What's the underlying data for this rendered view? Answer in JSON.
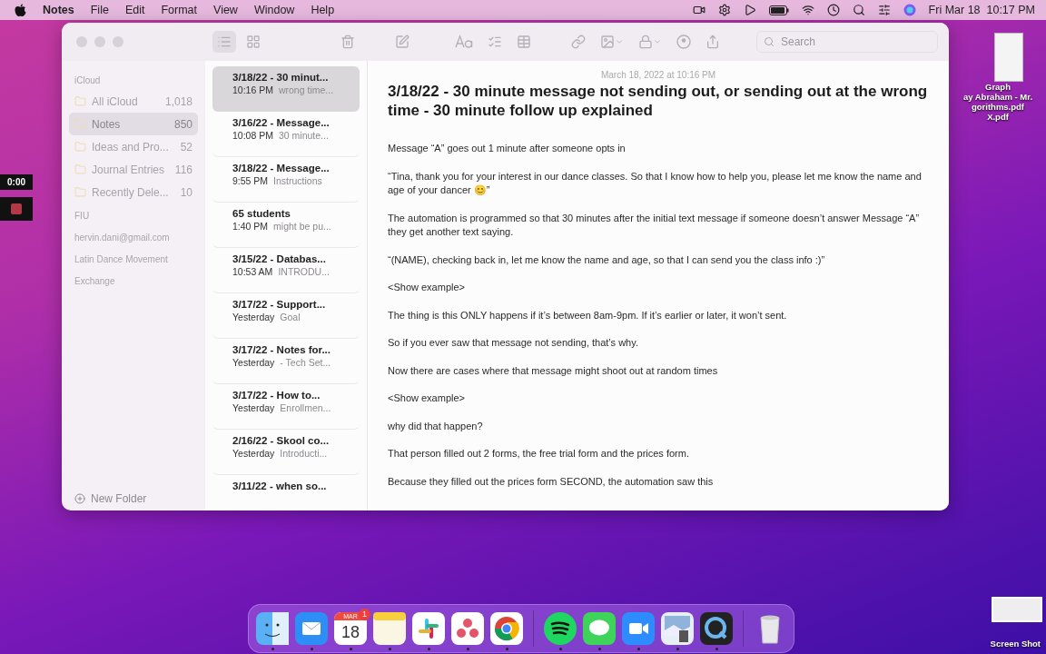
{
  "menu_bar": {
    "app_name": "Notes",
    "menus": [
      "File",
      "Edit",
      "Format",
      "View",
      "Window",
      "Help"
    ],
    "clock": "Fri Mar 18  10:17 PM"
  },
  "toolbar": {
    "view_modes": [
      {
        "kind": "list",
        "selected": true
      },
      {
        "kind": "grid",
        "selected": false
      }
    ],
    "search": {
      "placeholder": "Search"
    }
  },
  "sidebar": {
    "sections": [
      {
        "title": "iCloud",
        "folders": [
          {
            "name": "All iCloud",
            "count": "1,018",
            "selected": false
          },
          {
            "name": "Notes",
            "count": "850",
            "selected": true
          },
          {
            "name": "Ideas and Pro...",
            "count": "52",
            "selected": false
          },
          {
            "name": "Journal Entries",
            "count": "116",
            "selected": false
          },
          {
            "name": "Recently Dele...",
            "count": "10",
            "selected": false
          }
        ]
      },
      {
        "title": "FIU"
      },
      {
        "title": "hervin.dani@gmail.com"
      },
      {
        "title": "Latin Dance Movement"
      },
      {
        "title": "Exchange"
      }
    ],
    "new_folder": "New Folder"
  },
  "note_list": [
    {
      "title": "3/18/22 - 30 minut...",
      "time": "10:16 PM",
      "preview": "wrong time...",
      "selected": true
    },
    {
      "title": "3/16/22 - Message...",
      "time": "10:08 PM",
      "preview": "30 minute...",
      "selected": false
    },
    {
      "title": "3/18/22 - Message...",
      "time": "9:55 PM",
      "preview": "Instructions",
      "selected": false
    },
    {
      "title": "65 students",
      "time": "1:40 PM",
      "preview": "might be pu...",
      "selected": false
    },
    {
      "title": "3/15/22 - Databas...",
      "time": "10:53 AM",
      "preview": "INTRODU...",
      "selected": false
    },
    {
      "title": "3/17/22 - Support...",
      "time": "Yesterday",
      "preview": "Goal",
      "selected": false
    },
    {
      "title": "3/17/22 - Notes for...",
      "time": "Yesterday",
      "preview": "- Tech Set...",
      "selected": false
    },
    {
      "title": "3/17/22 - How to...",
      "time": "Yesterday",
      "preview": "Enrollmen...",
      "selected": false
    },
    {
      "title": "2/16/22 - Skool co...",
      "time": "Yesterday",
      "preview": "Introducti...",
      "selected": false
    },
    {
      "title": "3/11/22 - when so...",
      "selected": false
    }
  ],
  "note": {
    "date": "March 18, 2022 at 10:16 PM",
    "title": "3/18/22 - 30 minute message not sending out, or sending out at the wrong time - 30 minute follow up explained",
    "paragraphs": [
      "Message “A” goes out 1 minute after someone opts in",
      "“Tina, thank you for your interest in our dance classes. So that I know how to help you, please let me know the name and age of your dancer 😊”",
      "The automation is programmed so that 30 minutes after the initial text message if someone doesn’t answer Message “A” they get another text saying.",
      "“(NAME), checking back in, let me know the name and age, so that I can send you the class info :)”",
      "<Show example>",
      "The thing is this ONLY happens if it’s between 8am-9pm. If it’s earlier or later, it won’t sent.",
      "So if you ever saw that message not sending, that’s why.",
      "Now there are cases where that message might shoot out at random times",
      "<Show example>",
      "why did that happen?",
      "That person filled out 2 forms, the free trial form and the prices form.",
      "Because they filled out the prices form SECOND, the automation saw this"
    ]
  },
  "desktop": {
    "recorder": {
      "time": "0:00"
    },
    "file_labels": [
      "Graph",
      "ay Abraham - Mr.",
      "gorithms.pdf",
      "X.pdf"
    ],
    "screenshot_label": "Screen Shot"
  },
  "dock": {
    "calendar": {
      "month": "MAR",
      "day": "18",
      "badge": "1"
    },
    "apps": [
      {
        "kind": "finder",
        "running": true
      },
      {
        "kind": "mail",
        "running": true
      },
      {
        "kind": "calendar",
        "running": true
      },
      {
        "kind": "notes",
        "running": true
      },
      {
        "kind": "slack",
        "running": true
      },
      {
        "kind": "asana",
        "running": true
      },
      {
        "kind": "chrome",
        "running": true
      },
      {
        "kind": "divider"
      },
      {
        "kind": "spotify",
        "running": true
      },
      {
        "kind": "messages",
        "running": true
      },
      {
        "kind": "zoom",
        "running": true
      },
      {
        "kind": "preview",
        "running": true
      },
      {
        "kind": "quicktime",
        "running": true
      },
      {
        "kind": "divider"
      },
      {
        "kind": "trash"
      }
    ]
  }
}
